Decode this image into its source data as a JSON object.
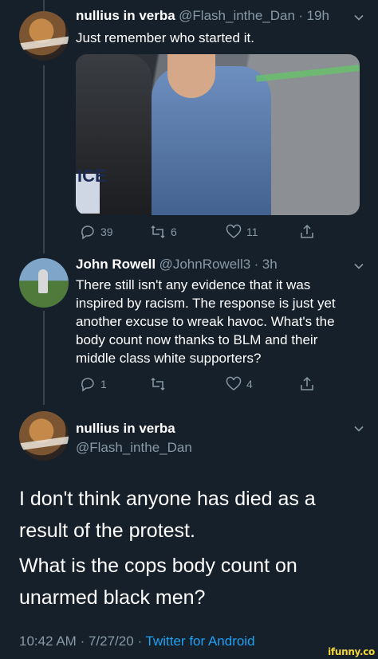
{
  "tweet1": {
    "name": "nullius in verba",
    "handle": "@Flash_inthe_Dan",
    "time": "19h",
    "text": "Just remember who started it.",
    "actions": {
      "reply_count": "39",
      "retweet_count": "6",
      "like_count": "11"
    },
    "media_text": "ICE"
  },
  "tweet2": {
    "name": "John Rowell",
    "handle": "@JohnRowell3",
    "time": "3h",
    "text": "There still isn't any evidence that it was inspired by racism. The response is just yet another excuse to wreak havoc. What's the body count now thanks to BLM and their middle class white supporters?",
    "actions": {
      "reply_count": "1",
      "retweet_count": "",
      "like_count": "4"
    }
  },
  "tweet3": {
    "name": "nullius in verba",
    "handle": "@Flash_inthe_Dan",
    "text_p1": "I don't think anyone has died as a result of the protest.",
    "text_p2": "What is the cops body count on unarmed black men?",
    "time": "10:42 AM",
    "date": "7/27/20",
    "source": "Twitter for Android"
  },
  "separator": "·",
  "watermark": "ifunny.co",
  "colors": {
    "background": "#15202b",
    "secondary_text": "#8899a6",
    "link": "#1da1f2",
    "divider": "#38444d"
  }
}
